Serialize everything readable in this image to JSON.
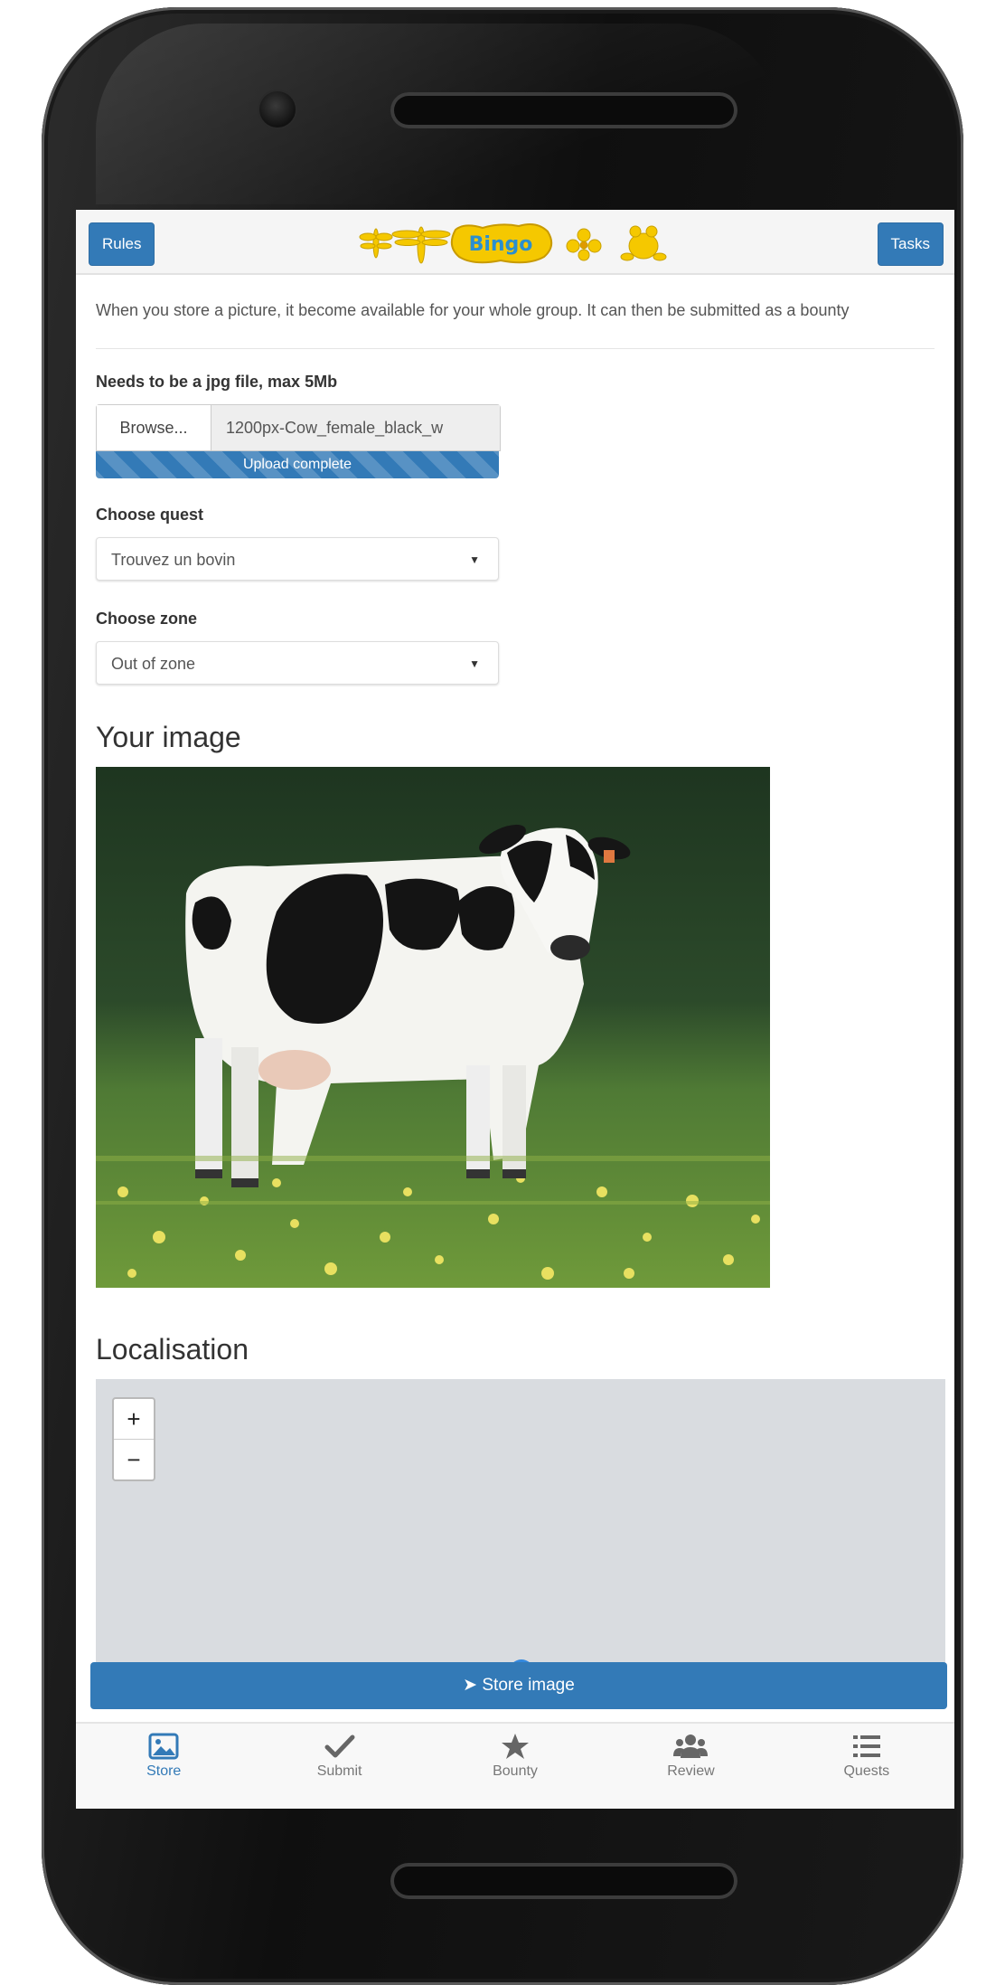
{
  "header": {
    "rules_label": "Rules",
    "tasks_label": "Tasks",
    "logo_text": "Bingo"
  },
  "intro_text": "When you store a picture, it become available for your whole group. It can then be submitted as a bounty",
  "upload": {
    "label": "Needs to be a jpg file, max 5Mb",
    "browse_label": "Browse...",
    "filename": "1200px-Cow_female_black_w",
    "progress_text": "Upload complete",
    "progress": 1.0
  },
  "quest": {
    "label": "Choose quest",
    "selected": "Trouvez un bovin"
  },
  "zone": {
    "label": "Choose zone",
    "selected": "Out of zone"
  },
  "image_section": {
    "title": "Your image"
  },
  "map_section": {
    "title": "Localisation",
    "zoom_in": "+",
    "zoom_out": "−"
  },
  "store_button": {
    "label": "Store image"
  },
  "nav": {
    "items": [
      {
        "label": "Store",
        "icon": "picture-icon"
      },
      {
        "label": "Submit",
        "icon": "check-icon"
      },
      {
        "label": "Bounty",
        "icon": "star-icon"
      },
      {
        "label": "Review",
        "icon": "users-icon"
      },
      {
        "label": "Quests",
        "icon": "list-icon"
      }
    ],
    "active": "Store"
  },
  "colors": {
    "primary": "#337ab7",
    "logo_yellow": "#f5c800"
  }
}
